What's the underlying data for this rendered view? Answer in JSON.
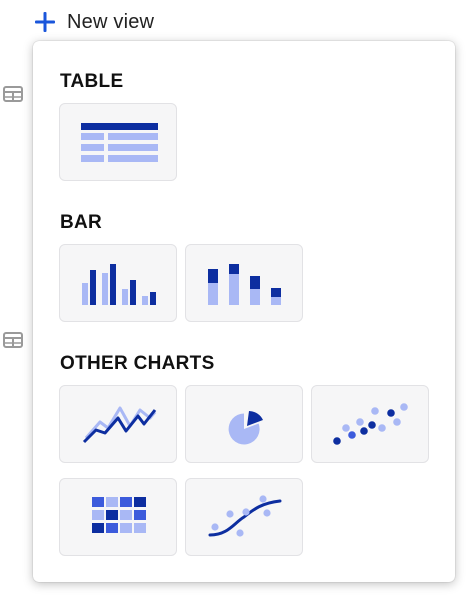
{
  "header": {
    "new_view_label": "New view",
    "new_view_icon": "plus-icon",
    "accent_color": "#1a56db"
  },
  "side_icons": [
    "table-icon",
    "table-icon"
  ],
  "menu": {
    "sections": [
      {
        "title": "TABLE",
        "options": [
          "table-chart-icon"
        ]
      },
      {
        "title": "BAR",
        "options": [
          "grouped-bar-chart-icon",
          "stacked-bar-chart-icon"
        ]
      },
      {
        "title": "OTHER CHARTS",
        "options": [
          "line-chart-icon",
          "pie-chart-icon",
          "scatter-plot-icon",
          "heatmap-icon",
          "trend-line-icon"
        ]
      }
    ]
  },
  "colors": {
    "dark_blue": "#0d2ea0",
    "mid_blue": "#3c5bdc",
    "light_blue": "#a9b8f5"
  }
}
